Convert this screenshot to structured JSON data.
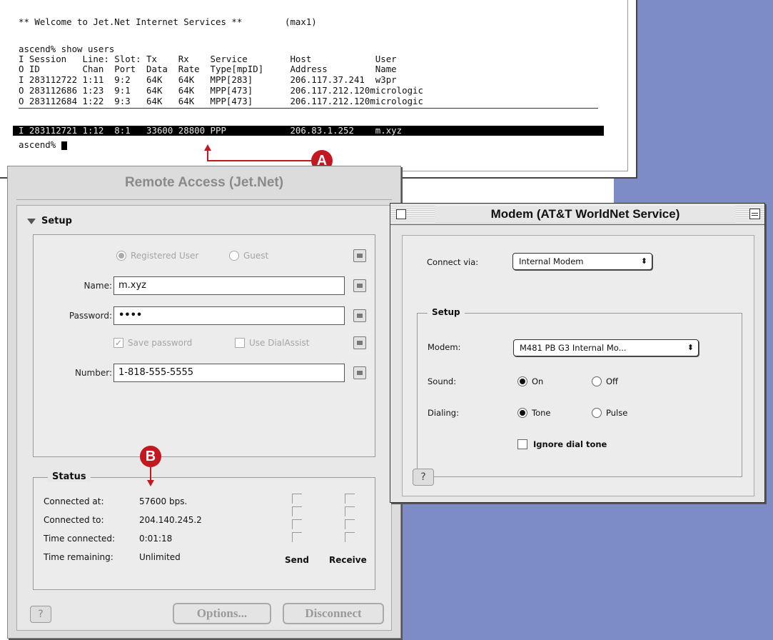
{
  "terminal": {
    "welcome": "** Welcome to Jet.Net Internet Services **",
    "host_tag": "(max1)",
    "command": "ascend% show users",
    "headers": [
      "I Session   Line: Slot: Tx    Rx    Service        Host            User",
      "O ID        Chan  Port  Data  Rate  Type[mpID]     Address         Name"
    ],
    "rows": [
      "I 283112722 1:11  9:2   64K   64K   MPP[283]       206.117.37.241  w3pr",
      "O 283112686 1:23  9:1   64K   64K   MPP[473]       206.117.212.120micrologic",
      "O 283112684 1:22  9:3   64K   64K   MPP[473]       206.117.212.120micrologic"
    ],
    "highlighted_row": "I 283112721 1:12  8:1   33600 28800 PPP            206.83.1.252    m.xyz",
    "prompt": "ascend% "
  },
  "remote_access": {
    "title": "Remote Access (Jet.Net)",
    "setup_label": "Setup",
    "registered_user": "Registered User",
    "guest": "Guest",
    "name_label": "Name:",
    "name_value": "m.xyz",
    "password_label": "Password:",
    "password_value": "••••",
    "save_password": "Save password",
    "use_dialassist": "Use DialAssist",
    "number_label": "Number:",
    "number_value": "1-818-555-5555",
    "status_label": "Status",
    "connected_at_label": "Connected at:",
    "connected_at_value": "57600 bps.",
    "connected_to_label": "Connected to:",
    "connected_to_value": "204.140.245.2",
    "time_connected_label": "Time connected:",
    "time_connected_value": "0:01:18",
    "time_remaining_label": "Time remaining:",
    "time_remaining_value": "Unlimited",
    "send_label": "Send",
    "receive_label": "Receive",
    "help_glyph": "?",
    "options_button": "Options...",
    "disconnect_button": "Disconnect"
  },
  "modem": {
    "title": "Modem (AT&T WorldNet Service)",
    "connect_via_label": "Connect via:",
    "connect_via_value": "Internal Modem",
    "setup_label": "Setup",
    "modem_label": "Modem:",
    "modem_value": "M481 PB G3 Internal Mo...",
    "sound_label": "Sound:",
    "sound_on": "On",
    "sound_off": "Off",
    "dialing_label": "Dialing:",
    "dialing_tone": "Tone",
    "dialing_pulse": "Pulse",
    "ignore_dial_tone": "Ignore dial tone",
    "help_glyph": "?"
  },
  "callouts": {
    "a": "A",
    "b": "B"
  },
  "colors": {
    "desktop": "#7d8bc6",
    "callout_red": "#c41820",
    "highlight_row": "#000000"
  }
}
